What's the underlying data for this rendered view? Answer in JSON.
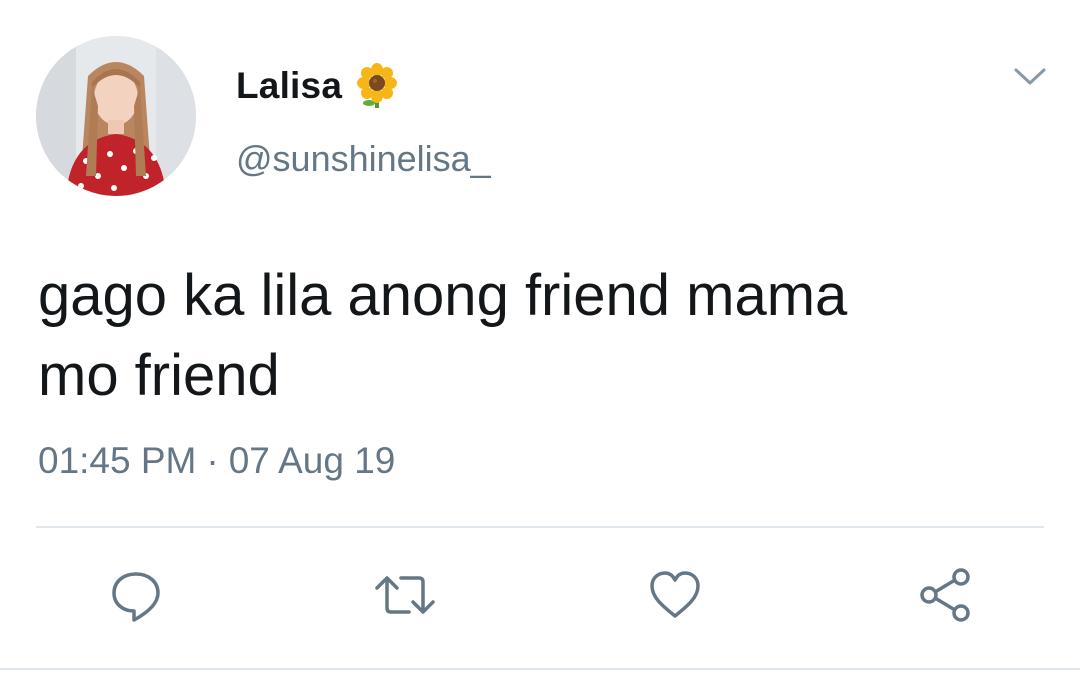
{
  "tweet": {
    "display_name": "Lalisa",
    "name_emoji_icon": "sunflower-icon",
    "handle": "@sunshinelisa_",
    "text_line1": "gago ka lila anong friend mama",
    "text_line2": "mo friend",
    "time": "01:45 PM",
    "separator": "·",
    "date": "07 Aug 19"
  },
  "icons": {
    "menu": "chevron-down-icon",
    "reply": "reply-icon",
    "retweet": "retweet-icon",
    "like": "heart-icon",
    "share": "share-icon"
  },
  "colors": {
    "text": "#14171a",
    "secondary": "#657786",
    "divider": "#e1e8ed"
  }
}
